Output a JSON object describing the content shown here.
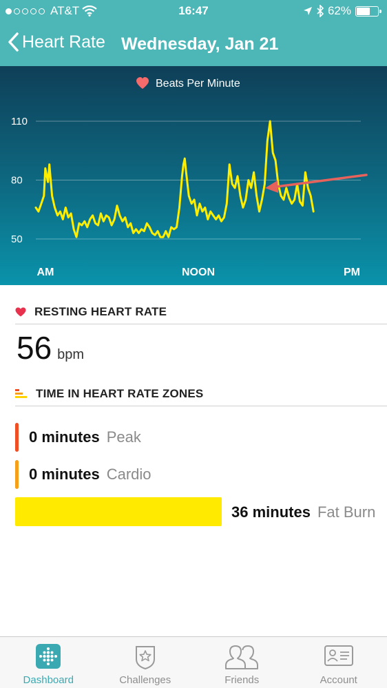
{
  "status_bar": {
    "carrier": "AT&T",
    "signal_bars_filled": 1,
    "signal_bars_total": 5,
    "time": "16:47",
    "battery_percent": "62%",
    "battery_level": 0.62,
    "icons": [
      "wifi-icon",
      "location-arrow-icon",
      "bluetooth-icon",
      "battery-icon"
    ]
  },
  "header": {
    "back_label": "Heart Rate",
    "date": "Wednesday, Jan 21",
    "color": "#4db6b6"
  },
  "chart_data": {
    "type": "line",
    "title": "Beats Per Minute",
    "legend_icon": "heart-icon",
    "ylim": [
      50,
      110
    ],
    "y_ticks": [
      "110",
      "80",
      "50"
    ],
    "x_labels": [
      "AM",
      "NOON",
      "PM"
    ],
    "x_domain_hours": [
      0,
      24
    ],
    "grid": true,
    "line_color": "#ffee00",
    "annotation": "arrow pointing to end of line",
    "series": [
      {
        "points": [
          [
            0.0,
            66
          ],
          [
            0.2,
            64
          ],
          [
            0.4,
            68
          ],
          [
            0.6,
            72
          ],
          [
            0.7,
            86
          ],
          [
            0.9,
            79
          ],
          [
            1.0,
            88
          ],
          [
            1.2,
            72
          ],
          [
            1.4,
            66
          ],
          [
            1.6,
            62
          ],
          [
            1.8,
            64
          ],
          [
            2.0,
            60
          ],
          [
            2.2,
            66
          ],
          [
            2.4,
            61
          ],
          [
            2.6,
            63
          ],
          [
            2.8,
            55
          ],
          [
            3.0,
            51
          ],
          [
            3.2,
            58
          ],
          [
            3.4,
            57
          ],
          [
            3.6,
            59
          ],
          [
            3.8,
            56
          ],
          [
            4.0,
            60
          ],
          [
            4.2,
            62
          ],
          [
            4.4,
            58
          ],
          [
            4.6,
            57
          ],
          [
            4.8,
            63
          ],
          [
            5.0,
            59
          ],
          [
            5.2,
            62
          ],
          [
            5.4,
            61
          ],
          [
            5.6,
            57
          ],
          [
            5.8,
            60
          ],
          [
            6.0,
            67
          ],
          [
            6.2,
            62
          ],
          [
            6.4,
            59
          ],
          [
            6.6,
            61
          ],
          [
            6.8,
            56
          ],
          [
            7.0,
            58
          ],
          [
            7.2,
            53
          ],
          [
            7.4,
            55
          ],
          [
            7.6,
            53
          ],
          [
            7.8,
            55
          ],
          [
            8.0,
            54
          ],
          [
            8.2,
            58
          ],
          [
            8.4,
            56
          ],
          [
            8.6,
            53
          ],
          [
            8.8,
            52
          ],
          [
            9.0,
            54
          ],
          [
            9.2,
            51
          ],
          [
            9.4,
            51
          ],
          [
            9.6,
            54
          ],
          [
            9.8,
            51
          ],
          [
            10.0,
            56
          ],
          [
            10.2,
            55
          ],
          [
            10.4,
            56
          ],
          [
            10.6,
            66
          ],
          [
            10.8,
            82
          ],
          [
            10.9,
            88
          ],
          [
            11.0,
            91
          ],
          [
            11.1,
            84
          ],
          [
            11.3,
            72
          ],
          [
            11.5,
            68
          ],
          [
            11.7,
            70
          ],
          [
            11.9,
            62
          ],
          [
            12.1,
            68
          ],
          [
            12.3,
            64
          ],
          [
            12.5,
            66
          ],
          [
            12.7,
            60
          ],
          [
            12.9,
            64
          ],
          [
            13.1,
            62
          ],
          [
            13.3,
            60
          ],
          [
            13.5,
            62
          ],
          [
            13.7,
            59
          ],
          [
            13.9,
            61
          ],
          [
            14.1,
            68
          ],
          [
            14.3,
            88
          ],
          [
            14.5,
            78
          ],
          [
            14.7,
            76
          ],
          [
            14.9,
            82
          ],
          [
            15.1,
            72
          ],
          [
            15.3,
            66
          ],
          [
            15.5,
            70
          ],
          [
            15.7,
            80
          ],
          [
            15.9,
            76
          ],
          [
            16.1,
            84
          ],
          [
            16.3,
            72
          ],
          [
            16.5,
            64
          ],
          [
            16.7,
            70
          ],
          [
            16.9,
            78
          ],
          [
            17.1,
            100
          ],
          [
            17.3,
            110
          ],
          [
            17.5,
            94
          ],
          [
            17.7,
            90
          ],
          [
            17.9,
            78
          ],
          [
            18.1,
            72
          ],
          [
            18.3,
            70
          ],
          [
            18.5,
            76
          ],
          [
            18.7,
            71
          ],
          [
            18.9,
            68
          ],
          [
            19.1,
            70
          ],
          [
            19.3,
            78
          ],
          [
            19.5,
            69
          ],
          [
            19.7,
            67
          ],
          [
            19.9,
            84
          ],
          [
            20.1,
            76
          ],
          [
            20.3,
            72
          ],
          [
            20.5,
            64
          ]
        ]
      }
    ]
  },
  "resting": {
    "title": "RESTING HEART RATE",
    "value": "56",
    "unit": "bpm",
    "icon": "heart-icon"
  },
  "zones": {
    "title": "TIME IN HEART RATE ZONES",
    "icon": "zones-icon",
    "items": [
      {
        "minutes": "0 minutes",
        "name": "Peak",
        "color": "#f04e23"
      },
      {
        "minutes": "0 minutes",
        "name": "Cardio",
        "color": "#f6a01a"
      },
      {
        "minutes": "36 minutes",
        "name": "Fat Burn",
        "color": "#ffea00"
      }
    ]
  },
  "tabbar": {
    "tabs": [
      {
        "label": "Dashboard",
        "icon": "dashboard-icon",
        "active": true
      },
      {
        "label": "Challenges",
        "icon": "challenges-icon",
        "active": false
      },
      {
        "label": "Friends",
        "icon": "friends-icon",
        "active": false
      },
      {
        "label": "Account",
        "icon": "account-icon",
        "active": false
      }
    ],
    "active_color": "#3ba9b1"
  }
}
